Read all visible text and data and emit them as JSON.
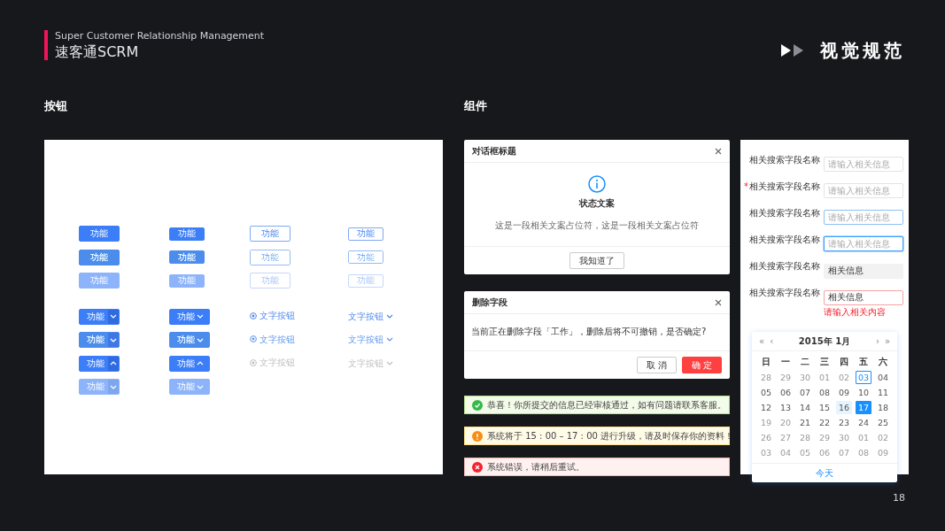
{
  "header": {
    "subtitle": "Super Customer Relationship Management",
    "title": "速客通SCRM",
    "heading": "视觉规范"
  },
  "buttons_section": {
    "label": "按钮",
    "rows": [
      [
        {
          "kind": "solid",
          "label": "功能",
          "hovered": false,
          "disabled": false
        },
        {
          "kind": "solid-small",
          "label": "功能",
          "hovered": false,
          "disabled": false
        },
        {
          "kind": "outline",
          "label": "功能",
          "hovered": false,
          "disabled": false
        },
        {
          "kind": "outline-small",
          "label": "功能",
          "hovered": false,
          "disabled": false
        }
      ],
      [
        {
          "kind": "solid",
          "label": "功能",
          "hovered": true,
          "disabled": false
        },
        {
          "kind": "solid-small",
          "label": "功能",
          "hovered": true,
          "disabled": false
        },
        {
          "kind": "outline",
          "label": "功能",
          "hovered": true,
          "disabled": false
        },
        {
          "kind": "outline-small",
          "label": "功能",
          "hovered": true,
          "disabled": false
        }
      ],
      [
        {
          "kind": "solid",
          "label": "功能",
          "hovered": false,
          "disabled": true
        },
        {
          "kind": "solid-small",
          "label": "功能",
          "hovered": false,
          "disabled": true
        },
        {
          "kind": "outline",
          "label": "功能",
          "hovered": false,
          "disabled": true
        },
        {
          "kind": "outline-small",
          "label": "功能",
          "hovered": false,
          "disabled": true
        }
      ],
      [
        {
          "kind": "split",
          "label": "功能",
          "hovered": false,
          "disabled": false,
          "expanded": false
        },
        {
          "kind": "split-small",
          "label": "功能",
          "hovered": false,
          "disabled": false,
          "expanded": false
        },
        {
          "kind": "text-icon",
          "label": "文字按钮",
          "hovered": false,
          "disabled": false
        },
        {
          "kind": "text-caret",
          "label": "文字按钮",
          "hovered": false,
          "disabled": false
        }
      ],
      [
        {
          "kind": "split",
          "label": "功能",
          "hovered": true,
          "disabled": false,
          "expanded": false
        },
        {
          "kind": "split-small",
          "label": "功能",
          "hovered": true,
          "disabled": false,
          "expanded": false
        },
        {
          "kind": "text-icon",
          "label": "文字按钮",
          "hovered": true,
          "disabled": false
        },
        {
          "kind": "text-caret",
          "label": "文字按钮",
          "hovered": true,
          "disabled": false
        }
      ],
      [
        {
          "kind": "split",
          "label": "功能",
          "hovered": false,
          "disabled": false,
          "expanded": true
        },
        {
          "kind": "split-small",
          "label": "功能",
          "hovered": false,
          "disabled": false,
          "expanded": true
        },
        {
          "kind": "text-icon",
          "label": "文字按钮",
          "hovered": false,
          "disabled": true
        },
        {
          "kind": "text-caret",
          "label": "文字按钮",
          "hovered": false,
          "disabled": true
        }
      ],
      [
        {
          "kind": "split",
          "label": "功能",
          "hovered": false,
          "disabled": true,
          "expanded": false
        },
        {
          "kind": "split-small",
          "label": "功能",
          "hovered": false,
          "disabled": true,
          "expanded": false
        }
      ]
    ]
  },
  "components_section": {
    "label": "组件",
    "info_dialog": {
      "title": "对话框标题",
      "status": "状态文案",
      "message": "这是一段相关文案占位符，这是一段相关文案占位符",
      "button": "我知道了"
    },
    "confirm_dialog": {
      "title": "删除字段",
      "message": "当前正在删除字段「工作」，删除后将不可撤销，是否确定?",
      "buttons": [
        {
          "label": "取 消",
          "kind": "default"
        },
        {
          "label": "确 定",
          "kind": "danger"
        }
      ]
    },
    "alerts": [
      {
        "kind": "success",
        "text": "恭喜！你所提交的信息已经审核通过，如有问题请联系客服。"
      },
      {
        "kind": "warning",
        "text": "系统将于 15 : 00 – 17 : 00 进行升级，请及时保存你的资料！"
      },
      {
        "kind": "error",
        "text": "系统错误，请稍后重试。"
      }
    ],
    "form": {
      "fields": [
        {
          "label": "相关搜索字段名称",
          "placeholder": "请输入相关信息",
          "hovered": false,
          "focused": false,
          "disabled": false,
          "invalid": false
        },
        {
          "required_mark": "*",
          "label": "相关搜索字段名称",
          "placeholder": "请输入相关信息",
          "hovered": false,
          "focused": false,
          "disabled": false,
          "invalid": false
        },
        {
          "label": "相关搜索字段名称",
          "placeholder": "请输入相关信息",
          "hovered": true,
          "focused": false,
          "disabled": false,
          "invalid": false
        },
        {
          "label": "相关搜索字段名称",
          "placeholder": "请输入相关信息",
          "hovered": false,
          "focused": true,
          "disabled": false,
          "invalid": false
        },
        {
          "label": "相关搜索字段名称",
          "value": "相关信息",
          "hovered": false,
          "focused": false,
          "disabled": true,
          "invalid": false
        },
        {
          "label": "相关搜索字段名称",
          "value": "相关信息",
          "hovered": false,
          "focused": false,
          "disabled": false,
          "invalid": true,
          "error": "请输入相关内容"
        }
      ]
    },
    "date_picker": {
      "prev_year": "«",
      "prev_month": "‹",
      "title": "2015年 1月",
      "next_month": "›",
      "next_year": "»",
      "weekdays": [
        "日",
        "一",
        "二",
        "三",
        "四",
        "五",
        "六"
      ],
      "weeks": [
        [
          {
            "label": "28",
            "disabled": true,
            "today": false,
            "hovered": false,
            "selected": false
          },
          {
            "label": "29",
            "disabled": true,
            "today": false,
            "hovered": false,
            "selected": false
          },
          {
            "label": "30",
            "disabled": true,
            "today": false,
            "hovered": false,
            "selected": false
          },
          {
            "label": "01",
            "disabled": true,
            "today": false,
            "hovered": false,
            "selected": false
          },
          {
            "label": "02",
            "disabled": true,
            "today": false,
            "hovered": false,
            "selected": false
          },
          {
            "label": "03",
            "disabled": false,
            "today": true,
            "hovered": false,
            "selected": false
          },
          {
            "label": "04",
            "disabled": false,
            "today": false,
            "hovered": false,
            "selected": false
          }
        ],
        [
          {
            "label": "05",
            "disabled": false,
            "today": false,
            "hovered": false,
            "selected": false
          },
          {
            "label": "06",
            "disabled": false,
            "today": false,
            "hovered": false,
            "selected": false
          },
          {
            "label": "07",
            "disabled": false,
            "today": false,
            "hovered": false,
            "selected": false
          },
          {
            "label": "08",
            "disabled": false,
            "today": false,
            "hovered": false,
            "selected": false
          },
          {
            "label": "09",
            "disabled": false,
            "today": false,
            "hovered": false,
            "selected": false
          },
          {
            "label": "10",
            "disabled": false,
            "today": false,
            "hovered": false,
            "selected": false
          },
          {
            "label": "11",
            "disabled": false,
            "today": false,
            "hovered": false,
            "selected": false
          }
        ],
        [
          {
            "label": "12",
            "disabled": false,
            "today": false,
            "hovered": false,
            "selected": false
          },
          {
            "label": "13",
            "disabled": false,
            "today": false,
            "hovered": false,
            "selected": false
          },
          {
            "label": "14",
            "disabled": false,
            "today": false,
            "hovered": false,
            "selected": false
          },
          {
            "label": "15",
            "disabled": false,
            "today": false,
            "hovered": false,
            "selected": false
          },
          {
            "label": "16",
            "disabled": false,
            "today": false,
            "hovered": true,
            "selected": false
          },
          {
            "label": "17",
            "disabled": false,
            "today": false,
            "hovered": false,
            "selected": true
          },
          {
            "label": "18",
            "disabled": false,
            "today": false,
            "hovered": false,
            "selected": false
          }
        ],
        [
          {
            "label": "19",
            "disabled": true,
            "today": false,
            "hovered": false,
            "selected": false
          },
          {
            "label": "20",
            "disabled": true,
            "today": false,
            "hovered": false,
            "selected": false
          },
          {
            "label": "21",
            "disabled": false,
            "today": false,
            "hovered": false,
            "selected": false
          },
          {
            "label": "22",
            "disabled": false,
            "today": false,
            "hovered": false,
            "selected": false
          },
          {
            "label": "23",
            "disabled": false,
            "today": false,
            "hovered": false,
            "selected": false
          },
          {
            "label": "24",
            "disabled": false,
            "today": false,
            "hovered": false,
            "selected": false
          },
          {
            "label": "25",
            "disabled": false,
            "today": false,
            "hovered": false,
            "selected": false
          }
        ],
        [
          {
            "label": "26",
            "disabled": true,
            "today": false,
            "hovered": false,
            "selected": false
          },
          {
            "label": "27",
            "disabled": true,
            "today": false,
            "hovered": false,
            "selected": false
          },
          {
            "label": "28",
            "disabled": true,
            "today": false,
            "hovered": false,
            "selected": false
          },
          {
            "label": "29",
            "disabled": true,
            "today": false,
            "hovered": false,
            "selected": false
          },
          {
            "label": "30",
            "disabled": true,
            "today": false,
            "hovered": false,
            "selected": false
          },
          {
            "label": "01",
            "disabled": true,
            "today": false,
            "hovered": false,
            "selected": false
          },
          {
            "label": "02",
            "disabled": true,
            "today": false,
            "hovered": false,
            "selected": false
          }
        ],
        [
          {
            "label": "03",
            "disabled": true,
            "today": false,
            "hovered": false,
            "selected": false
          },
          {
            "label": "04",
            "disabled": true,
            "today": false,
            "hovered": false,
            "selected": false
          },
          {
            "label": "05",
            "disabled": true,
            "today": false,
            "hovered": false,
            "selected": false
          },
          {
            "label": "06",
            "disabled": true,
            "today": false,
            "hovered": false,
            "selected": false
          },
          {
            "label": "07",
            "disabled": true,
            "today": false,
            "hovered": false,
            "selected": false
          },
          {
            "label": "08",
            "disabled": true,
            "today": false,
            "hovered": false,
            "selected": false
          },
          {
            "label": "09",
            "disabled": true,
            "today": false,
            "hovered": false,
            "selected": false
          }
        ]
      ],
      "today_button": "今天"
    }
  },
  "page_number": "18"
}
